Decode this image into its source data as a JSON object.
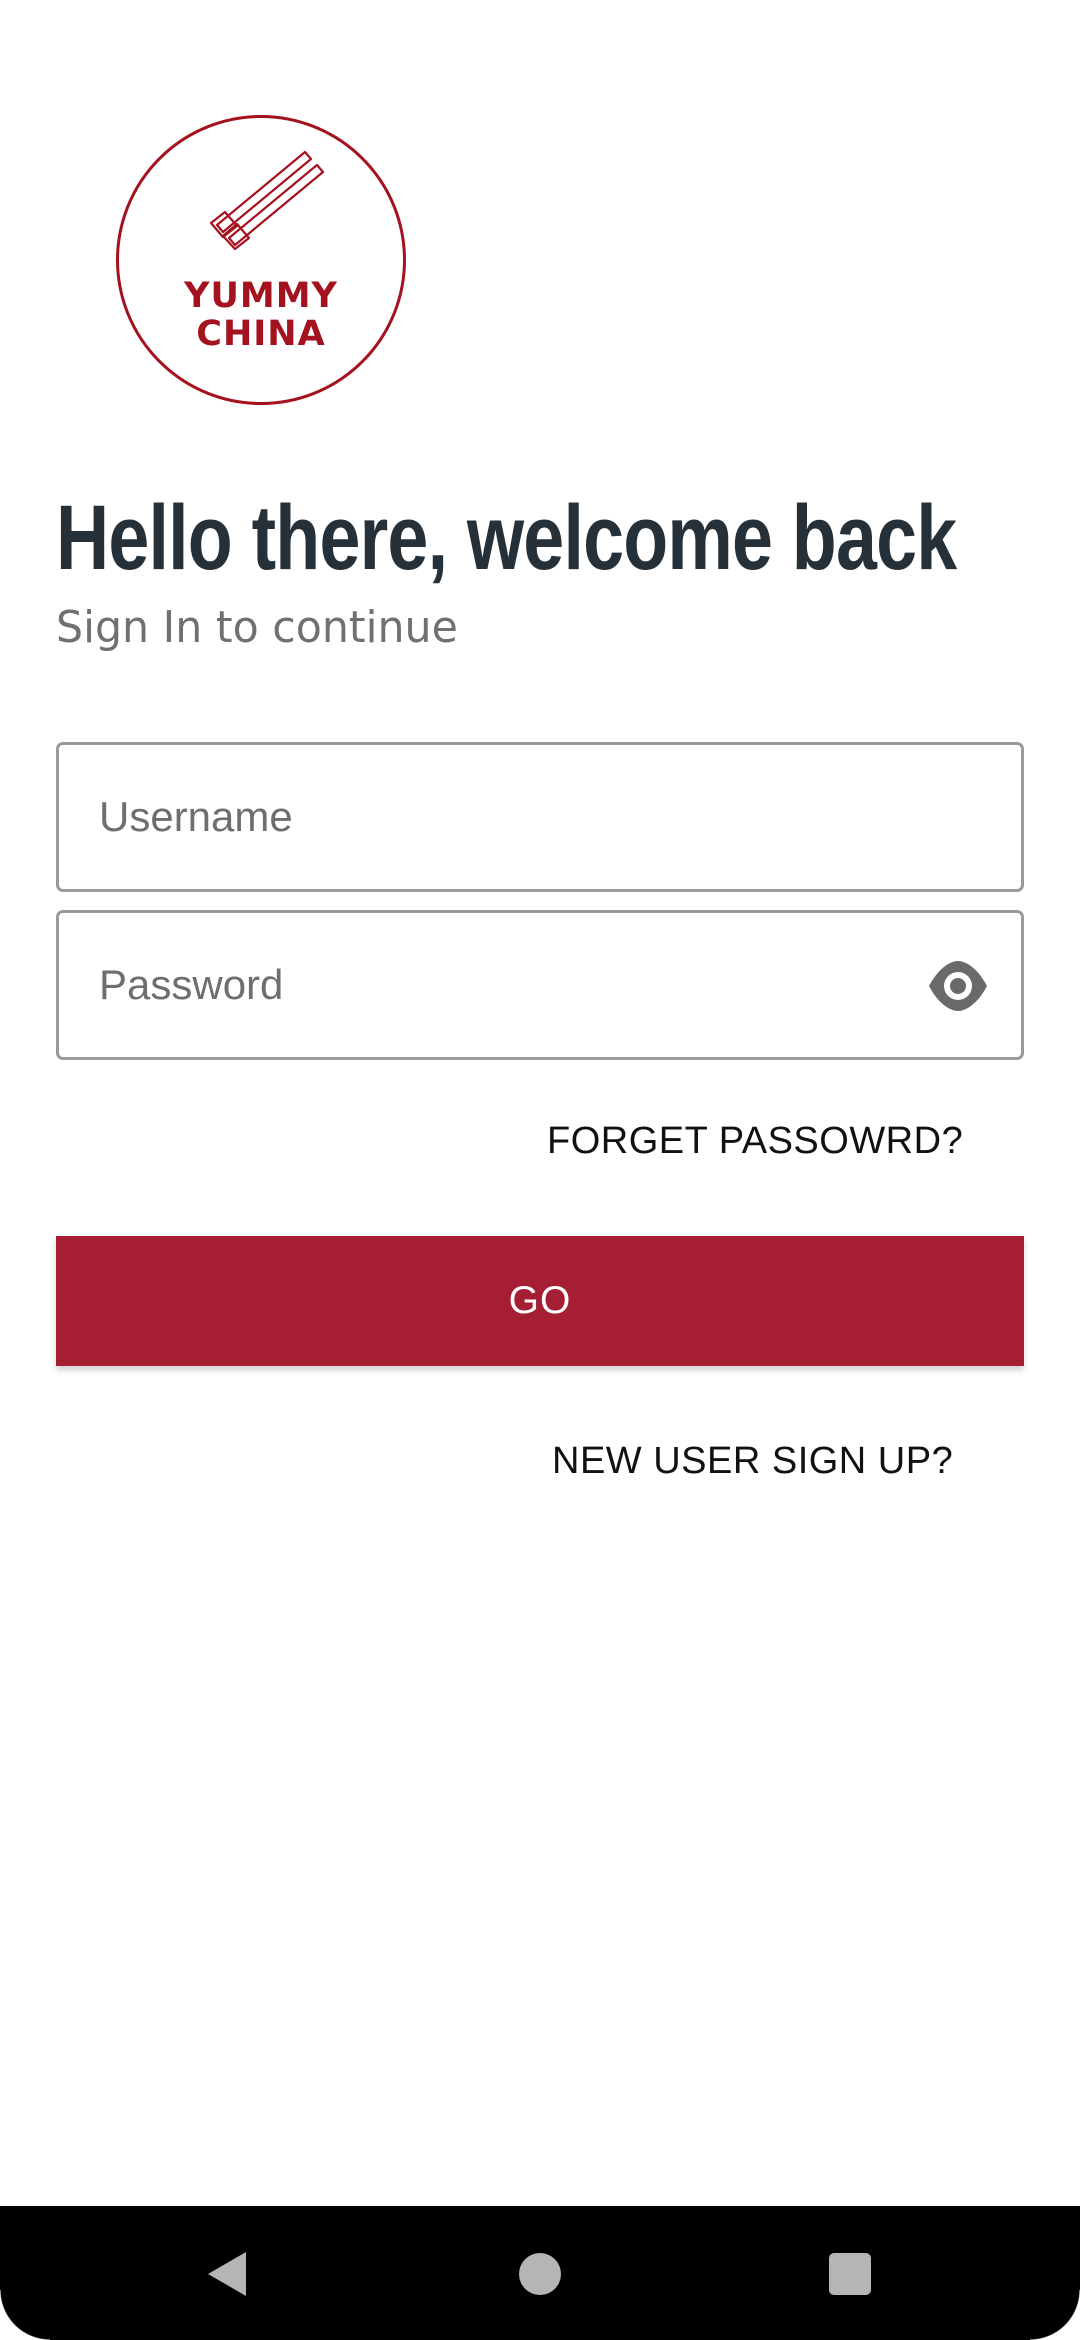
{
  "logo": {
    "line1": "YUMMY",
    "line2": "CHINA",
    "icon": "chopsticks-icon",
    "color": "#a5121f"
  },
  "header": {
    "title": "Hello there, welcome back",
    "subtitle": "Sign In to continue"
  },
  "form": {
    "username_placeholder": "Username",
    "username_value": "",
    "password_placeholder": "Password",
    "password_value": "",
    "password_toggle_icon": "eye-icon"
  },
  "links": {
    "forgot": "FORGET PASSOWRD?",
    "signup": "NEW USER SIGN UP?"
  },
  "actions": {
    "go_label": "GO",
    "go_color": "#a61e33"
  },
  "navbar": {
    "back_icon": "back-triangle-icon",
    "home_icon": "home-circle-icon",
    "recents_icon": "recents-square-icon"
  }
}
